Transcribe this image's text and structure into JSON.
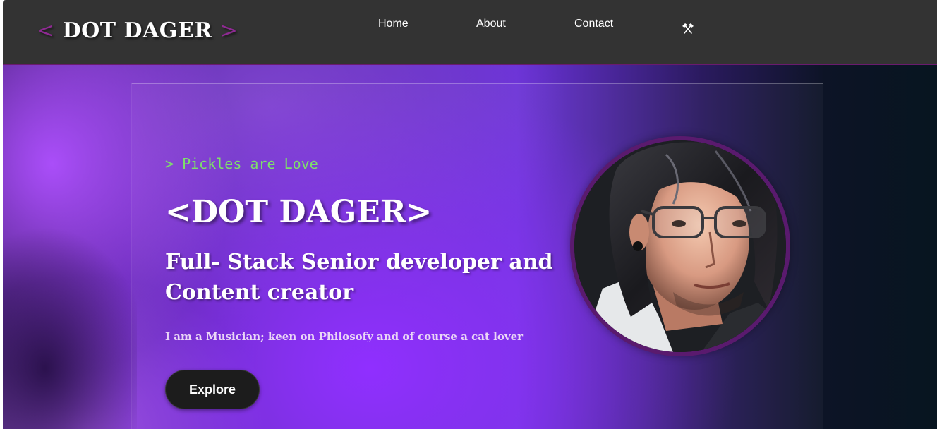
{
  "nav": {
    "brand": "DOT DAGER",
    "brand_left": "<",
    "brand_right": ">",
    "links": [
      "Home",
      "About",
      "Contact"
    ],
    "tools_icon": "hammer-pick-icon"
  },
  "hero": {
    "tagline": "> Pickles are Love",
    "title": "<DOT DAGER>",
    "subtitle": "Full- Stack Senior developer and Content creator",
    "description": "I am a Musician; keen on Philosofy and of course a cat lover",
    "cta_label": "Explore"
  },
  "colors": {
    "navbar_bg": "#333333",
    "accent_purple": "#8e2a92",
    "tagline_green": "#7ee06a",
    "button_bg": "#1c1c1c"
  }
}
